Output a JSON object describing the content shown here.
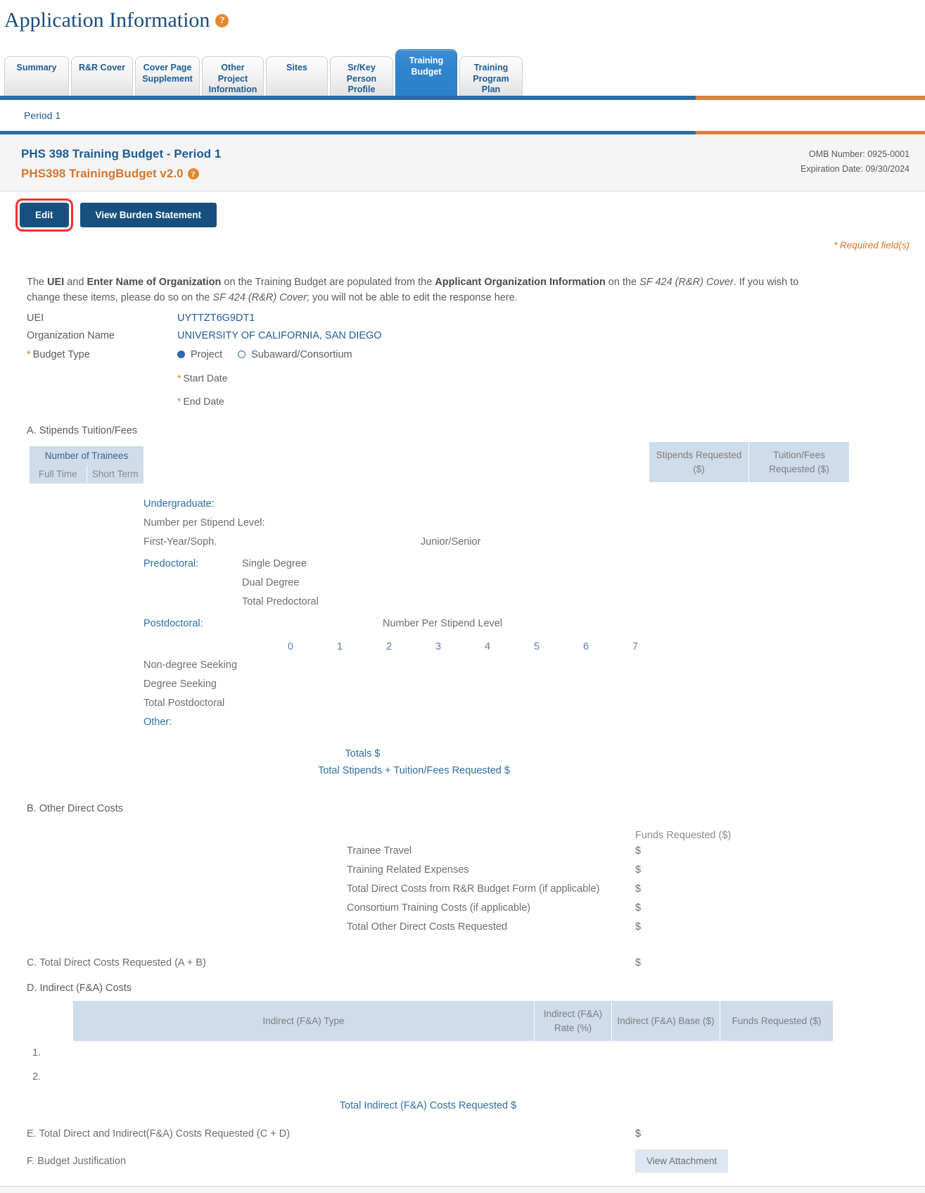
{
  "page": {
    "title": "Application Information",
    "help_icon": "help-icon",
    "required_note": "* Required field(s)"
  },
  "tabs": [
    {
      "label": "Summary",
      "active": false
    },
    {
      "label": "R&R Cover",
      "active": false
    },
    {
      "label": "Cover Page Supplement",
      "active": false
    },
    {
      "label": "Other Project Information",
      "active": false
    },
    {
      "label": "Sites",
      "active": false
    },
    {
      "label": "Sr/Key Person Profile",
      "active": false
    },
    {
      "label": "Training Budget",
      "active": true
    },
    {
      "label": "Training Program Plan",
      "active": false
    }
  ],
  "period_nav": {
    "alert_icon": "exclamation-icon",
    "label": "Period 1"
  },
  "form_header": {
    "title": "PHS 398 Training Budget - Period 1",
    "version": "PHS398 TrainingBudget v2.0",
    "omb_number": "OMB Number: 0925-0001",
    "expiration": "Expiration Date: 09/30/2024"
  },
  "actions": {
    "edit": "Edit",
    "burden": "View Burden Statement"
  },
  "intro": {
    "p1": "The ",
    "b1": "UEI",
    "p2": " and ",
    "b2": "Enter Name of Organization",
    "p3": " on the Training Budget are populated from the ",
    "b3": "Applicant Organization Information",
    "p4": " on the ",
    "i1": "SF 424 (R&R) Cover",
    "p5": ". If you wish to change these items, please do so on the ",
    "i2": "SF 424 (R&R) Cover",
    "p6": "; you will not be able to edit the response here."
  },
  "fields": {
    "uei_label": "UEI",
    "uei_value": "UYTTZT6G9DT1",
    "org_label": "Organization Name",
    "org_value": "UNIVERSITY OF CALIFORNIA, SAN DIEGO",
    "budget_type_label": "Budget Type",
    "budget_type_options": [
      "Project",
      "Subaward/Consortium"
    ],
    "budget_type_selected": "Project",
    "start_date_label": "Start Date",
    "end_date_label": "End Date",
    "asterisk": "*"
  },
  "section_a": {
    "heading": "A. Stipends Tuition/Fees",
    "trainee_header": "Number of Trainees",
    "trainee_cols": [
      "Full Time",
      "Short Term"
    ],
    "money_cols": [
      "Stipends Requested ($)",
      "Tuition/Fees Requested ($)"
    ],
    "undergraduate": "Undergraduate:",
    "number_per_stipend_level": "Number per Stipend Level:",
    "first_year_soph": "First-Year/Soph.",
    "junior_senior": "Junior/Senior",
    "predoctoral": "Predoctoral:",
    "predoc_rows": [
      "Single Degree",
      "Dual Degree",
      "Total Predoctoral"
    ],
    "postdoctoral": "Postdoctoral:",
    "postdoc_level_header": "Number Per Stipend Level",
    "postdoc_levels": [
      "0",
      "1",
      "2",
      "3",
      "4",
      "5",
      "6",
      "7"
    ],
    "postdoc_rows": [
      "Non-degree Seeking",
      "Degree Seeking",
      "Total Postdoctoral"
    ],
    "other": "Other:",
    "totals": "Totals $",
    "grand_total": "Total Stipends + Tuition/Fees Requested $"
  },
  "section_b": {
    "heading": "B. Other Direct Costs",
    "funds_header": "Funds Requested ($)",
    "rows": [
      {
        "label": "Trainee Travel",
        "value": "$"
      },
      {
        "label": "Training Related Expenses",
        "value": "$"
      },
      {
        "label": "Total Direct Costs from R&R Budget Form (if applicable)",
        "value": "$"
      },
      {
        "label": "Consortium Training Costs (if applicable)",
        "value": "$"
      },
      {
        "label": "Total Other Direct Costs Requested",
        "value": "$"
      }
    ]
  },
  "section_c": {
    "label": "C. Total Direct Costs Requested (A + B)",
    "value": "$"
  },
  "section_d": {
    "heading": "D. Indirect (F&A) Costs",
    "columns": [
      "Indirect (F&A) Type",
      "Indirect (F&A) Rate (%)",
      "Indirect (F&A) Base ($)",
      "Funds Requested ($)"
    ],
    "row_numbers": [
      "1.",
      "2."
    ],
    "total_label": "Total Indirect (F&A) Costs Requested $"
  },
  "section_e": {
    "label": "E. Total Direct and Indirect(F&A) Costs Requested (C + D)",
    "value": "$"
  },
  "section_f": {
    "label": "F. Budget Justification",
    "button": "View Attachment"
  },
  "colors": {
    "accent_blue": "#1d5c96",
    "accent_orange": "#d4762f",
    "table_header": "#cfdcea",
    "button_blue": "#17507f",
    "highlight_red": "#ff2d2d"
  }
}
